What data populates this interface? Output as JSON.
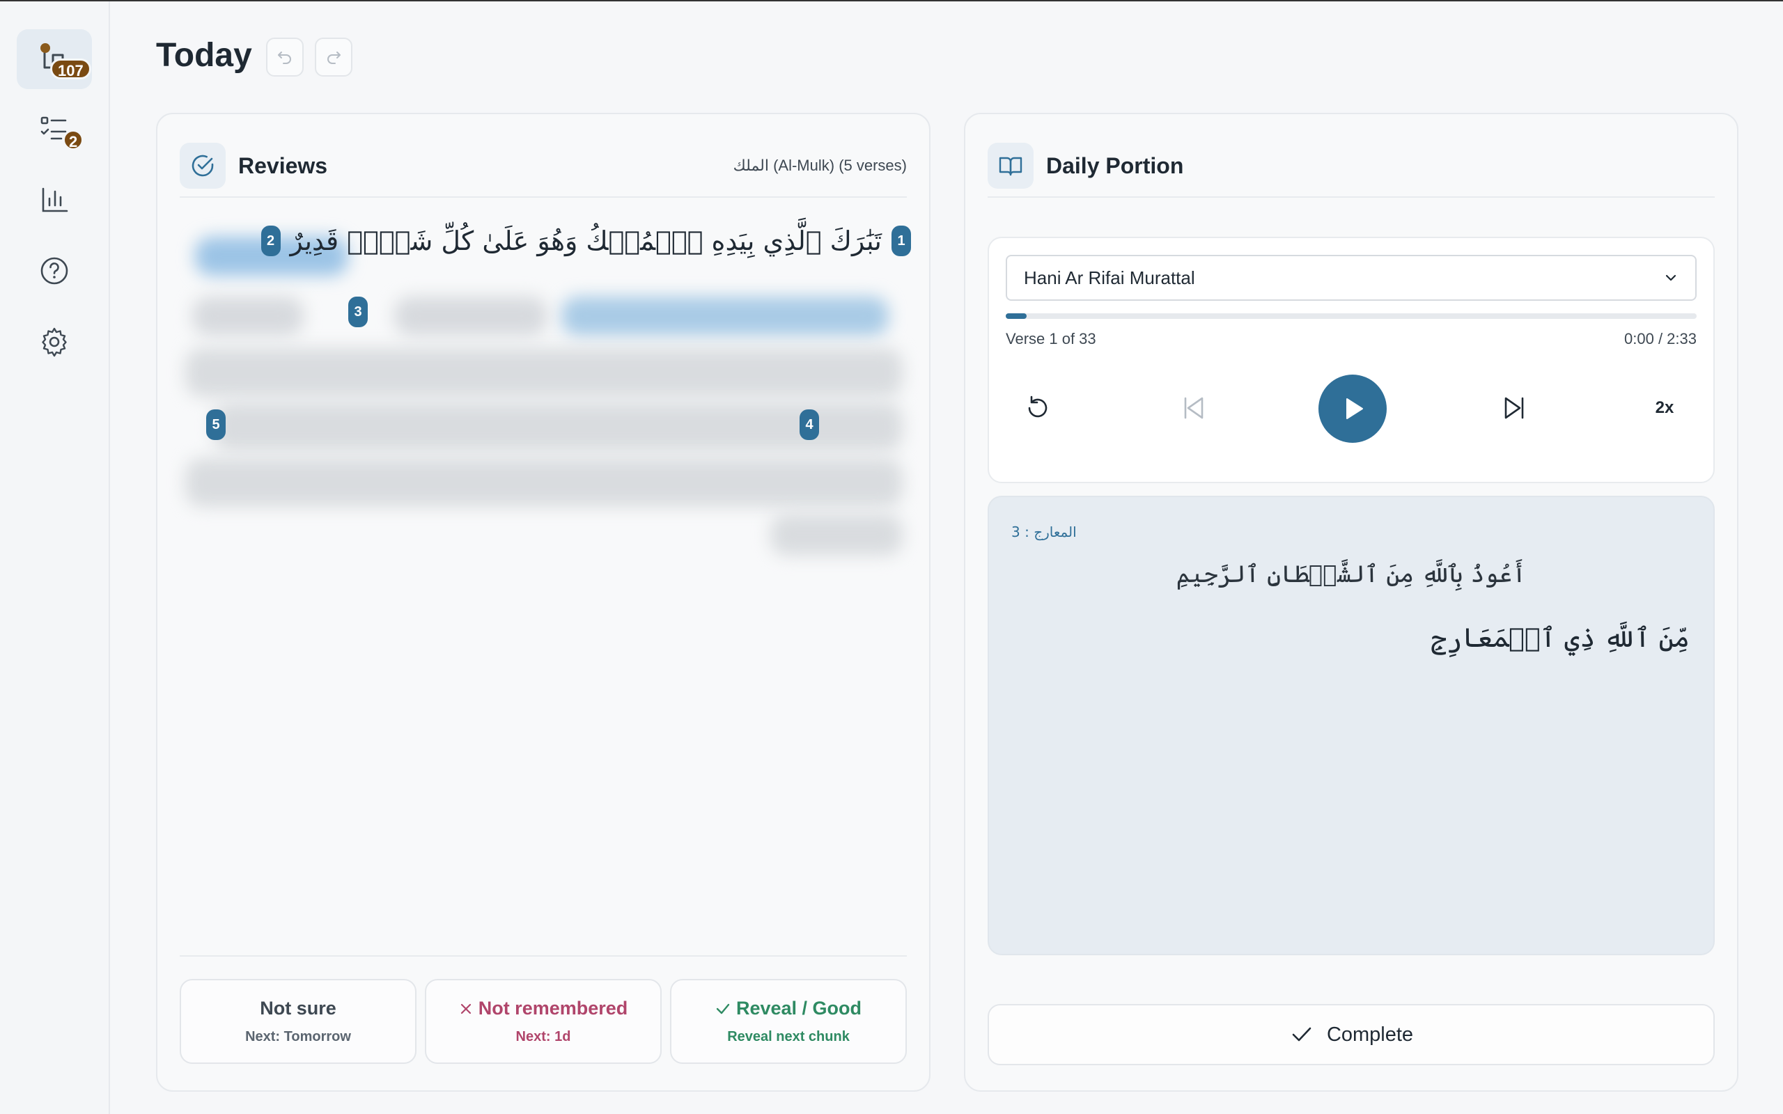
{
  "sidebar": {
    "items": [
      {
        "name": "memorize",
        "badge": "107"
      },
      {
        "name": "tasks",
        "badge": "2"
      },
      {
        "name": "stats"
      },
      {
        "name": "help"
      },
      {
        "name": "settings"
      }
    ]
  },
  "header": {
    "title": "Today"
  },
  "reviews": {
    "title": "Reviews",
    "surah_meta": "الملك (Al-Mulk) (5 verses)",
    "verse1_text": "تَبَٰرَكَ ٱلَّذِي بِيَدِهِ ٱلۡمُلۡكُ وَهُوَ عَلَىٰ كُلِّ شَيۡءٖ قَدِيرٌ",
    "verse_numbers": [
      "1",
      "2",
      "3",
      "4",
      "5"
    ],
    "buttons": [
      {
        "label": "Not sure",
        "sub": "Next: Tomorrow"
      },
      {
        "label": "Not remembered",
        "sub": "Next: 1d"
      },
      {
        "label": "Reveal / Good",
        "sub": "Reveal next chunk"
      }
    ]
  },
  "daily": {
    "title": "Daily Portion",
    "reciter": "Hani Ar Rifai Murattal",
    "progress": 0.03,
    "verse_position": "Verse 1 of 33",
    "time": "0:00 / 2:33",
    "speed": "2x",
    "reference": "المعارج : 3",
    "istiadha": "أَعُوذُ بِٱللَّهِ مِنَ ٱلشَّيۡطَانِ ٱلرَّجِيمِ",
    "verse_text": "مِّنَ ٱللَّهِ ذِي ٱلۡمَعَارِجِ",
    "complete_label": "Complete"
  },
  "colors": {
    "accent": "#2f6f98",
    "badge": "#7a4a12",
    "danger": "#b0456b",
    "success": "#2e8a62"
  }
}
